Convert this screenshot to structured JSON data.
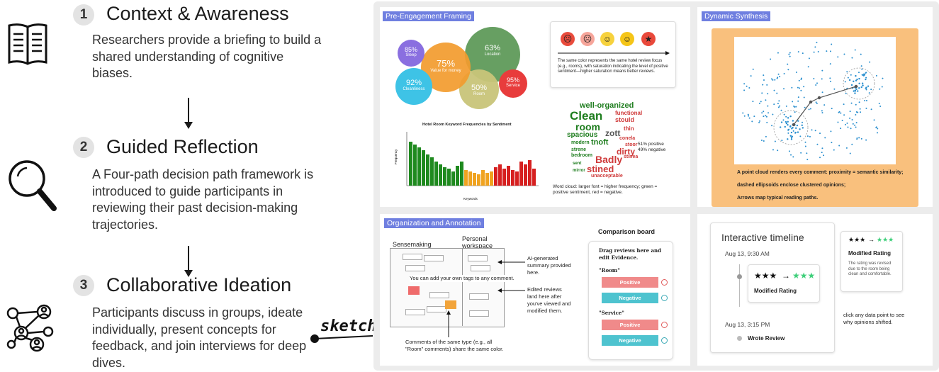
{
  "steps": [
    {
      "num": "1",
      "title": "Context & Awareness",
      "body": "Researchers provide a briefing to build a shared understanding of cognitive biases."
    },
    {
      "num": "2",
      "title": "Guided Reflection",
      "body": "A Four-path decision path framework is introduced to guide participants in reviewing their past decision-making trajectories."
    },
    {
      "num": "3",
      "title": "Collaborative Ideation",
      "body": "Participants discuss in groups, ideate individually, present concepts for feedback, and join interviews for deep dives."
    }
  ],
  "sketch_label": "sketch",
  "panels": {
    "pre_engagement": {
      "tag": "Pre-Engagement Framing",
      "bubbles": [
        {
          "value": "85%",
          "label": "Sleep",
          "color": "#8a6fe0"
        },
        {
          "value": "75%",
          "label": "Value for money",
          "color": "#f39c2e"
        },
        {
          "value": "63%",
          "label": "Location",
          "color": "#5f9a5a"
        },
        {
          "value": "92%",
          "label": "Cleanliness",
          "color": "#3ec3e6"
        },
        {
          "value": "50%",
          "label": "Room",
          "color": "#c9c57a"
        },
        {
          "value": "95%",
          "label": "Service",
          "color": "#e83c3c"
        }
      ],
      "sentiment_caption": "The same color represents the same hotel review focus (e.g., rooms), with saturation indicating the level of positive sentiment—higher saturation means better reviews.",
      "bar_chart_title": "Hotel Room Keyword Frequencies by Sentiment",
      "bar_chart_ylabel": "Frequency",
      "bar_chart_xlabel": "Keywords",
      "wordcloud_words": [
        "well-organized",
        "Clean",
        "functional",
        "stould",
        "room",
        "spacious",
        "zott",
        "thin",
        "modern",
        "tnoft",
        "conela",
        "stoor",
        "strene",
        "dirty",
        "bedroom",
        "Badly",
        "stinea",
        "stined",
        "unacceptable",
        "sent",
        "mirror"
      ],
      "wordcloud_stats": [
        "51% positive",
        "49% negative"
      ],
      "wordcloud_caption": "Word cloud: larger font = higher frequency; green = positive sentiment, red = negative."
    },
    "dynamic": {
      "tag": "Dynamic Synthesis",
      "caption_lines": [
        "A point cloud renders every comment: proximity = semantic similarity;",
        "dashed ellipsoids enclose clustered opinions;",
        "Arrows map typical reading paths."
      ]
    },
    "organization": {
      "tag": "Organization and Annotation",
      "sensemaking": "Sensemaking",
      "personal": "Personal workspace",
      "ai_summary": "AI-generated summary provided here.",
      "add_tags": "You can add your own tags to any comment.",
      "edited": "Edited reviews land here after you've viewed and modified them.",
      "same_type": "Comments of the same type (e.g., all \"Room\" comments) share the same color.",
      "comparison_title": "Comparison board",
      "comparison_instr": "Drag reviews here and edit Evidence.",
      "groups": [
        {
          "name": "\"Room\"",
          "positive": "Positive",
          "negative": "Negative"
        },
        {
          "name": "\"Service\"",
          "positive": "Positive",
          "negative": "Negative"
        }
      ]
    },
    "timeline": {
      "title": "Interactive timeline",
      "date1": "Aug 13, 9:30 AM",
      "stars_from": "★★★",
      "arrow": "→",
      "stars_to": "★★★",
      "card_label": "Modified Rating",
      "date2": "Aug 13, 3:15 PM",
      "wrote": "Wrote Review",
      "side_title": "Modified Rating",
      "side_body": "The rating was revised due to the room being clean and comfortable.",
      "hint": "click any data point to see why opinions shifted."
    }
  },
  "colors": {
    "tag_bg": "#6f7fe0",
    "orange_panel": "#f9c07d",
    "positive": "#f08a8a",
    "negative": "#4ec3cf",
    "star_green": "#3ecf7a"
  }
}
